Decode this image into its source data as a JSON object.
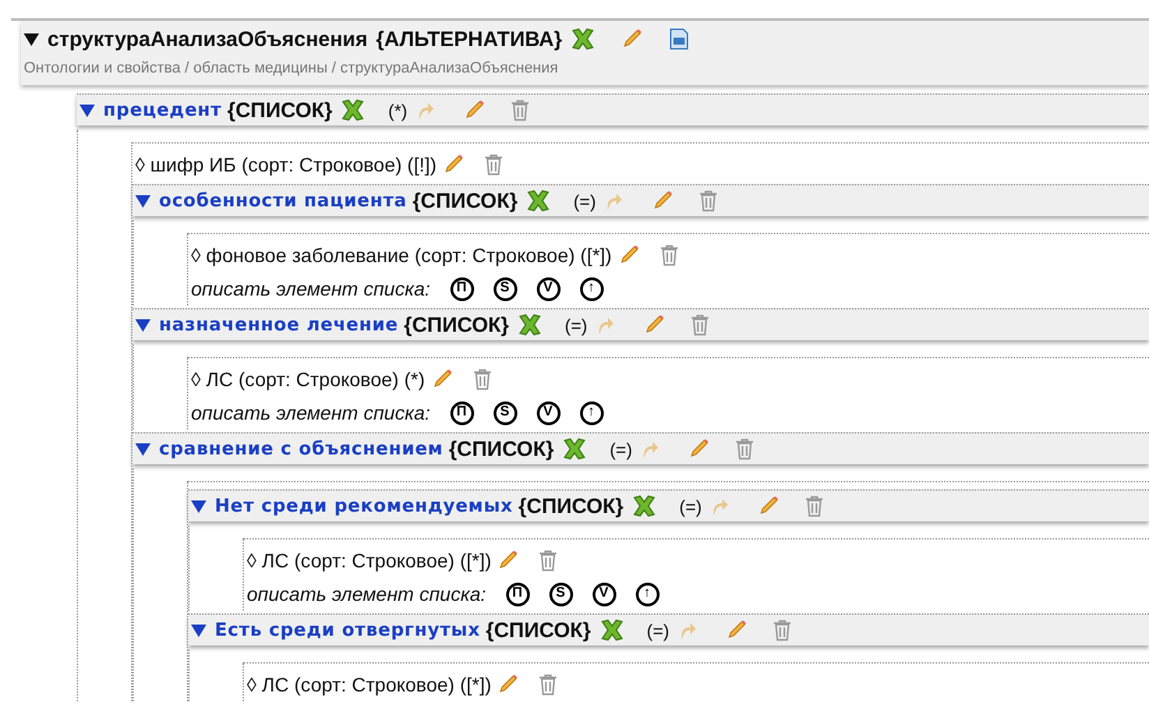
{
  "header": {
    "title": "структураАнализаОбъяснения",
    "type": "{АЛЬТЕРНАТИВА}",
    "breadcrumb": "Онтологии и свойства / область медицины / структураАнализаОбъяснения"
  },
  "tree": [
    {
      "kind": "list",
      "title": "прецедент",
      "type": "{СПИСОК}",
      "flag": "(*)",
      "expanded": true,
      "children": [
        {
          "kind": "leaf",
          "label": "◊ шифр ИБ (сорт: Строковое) ([!])"
        },
        {
          "kind": "list",
          "title": "особенности пациента",
          "type": "{СПИСОК}",
          "flag": "(=)",
          "expanded": true,
          "children": [
            {
              "kind": "leaf",
              "label": "◊ фоновое заболевание (сорт: Строковое) ([*])"
            },
            {
              "kind": "describe",
              "label": "описать элемент списка:",
              "buttons": [
                "П",
                "S",
                "V",
                "↑"
              ]
            }
          ]
        },
        {
          "kind": "list",
          "title": "назначенное лечение",
          "type": "{СПИСОК}",
          "flag": "(=)",
          "expanded": true,
          "children": [
            {
              "kind": "leaf",
              "label": "◊ ЛС (сорт: Строковое) (*)"
            },
            {
              "kind": "describe",
              "label": "описать элемент списка:",
              "buttons": [
                "П",
                "S",
                "V",
                "↑"
              ]
            }
          ]
        },
        {
          "kind": "list",
          "title": "сравнение с объяснением",
          "type": "{СПИСОК}",
          "flag": "(=)",
          "expanded": true,
          "children": [
            {
              "kind": "list",
              "title": "Нет среди рекомендуемых",
              "type": "{СПИСОК}",
              "flag": "(=)",
              "expanded": true,
              "children": [
                {
                  "kind": "leaf",
                  "label": "◊ ЛС (сорт: Строковое) ([*])"
                },
                {
                  "kind": "describe",
                  "label": "описать элемент списка:",
                  "buttons": [
                    "П",
                    "S",
                    "V",
                    "↑"
                  ]
                }
              ]
            },
            {
              "kind": "list",
              "title": "Есть среди отвергнутых",
              "type": "{СПИСОК}",
              "flag": "(=)",
              "expanded": true,
              "children": [
                {
                  "kind": "leaf",
                  "label": "◊ ЛС (сорт: Строковое) ([*])"
                }
              ]
            }
          ]
        }
      ]
    }
  ]
}
